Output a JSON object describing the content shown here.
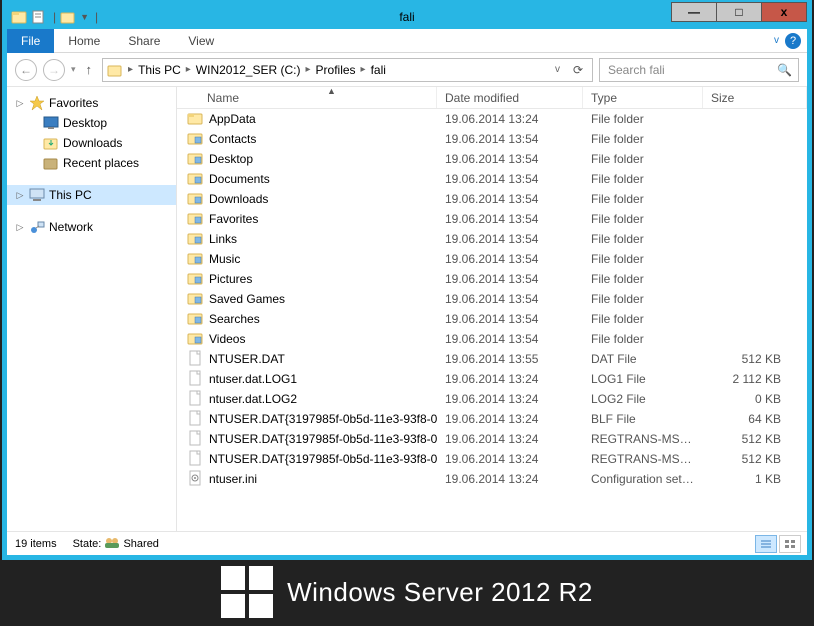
{
  "window": {
    "title": "fali"
  },
  "ribbon": {
    "file": "File",
    "tabs": [
      "Home",
      "Share",
      "View"
    ]
  },
  "breadcrumbs": [
    "This PC",
    "WIN2012_SER (C:)",
    "Profiles",
    "fali"
  ],
  "search": {
    "placeholder": "Search fali"
  },
  "navpane": {
    "favorites": {
      "label": "Favorites",
      "items": [
        "Desktop",
        "Downloads",
        "Recent places"
      ]
    },
    "thispc": {
      "label": "This PC"
    },
    "network": {
      "label": "Network"
    }
  },
  "columns": {
    "name": "Name",
    "date": "Date modified",
    "type": "Type",
    "size": "Size"
  },
  "rows": [
    {
      "icon": "folder",
      "name": "AppData",
      "date": "19.06.2014 13:24",
      "type": "File folder",
      "size": ""
    },
    {
      "icon": "special",
      "name": "Contacts",
      "date": "19.06.2014 13:54",
      "type": "File folder",
      "size": ""
    },
    {
      "icon": "special",
      "name": "Desktop",
      "date": "19.06.2014 13:54",
      "type": "File folder",
      "size": ""
    },
    {
      "icon": "special",
      "name": "Documents",
      "date": "19.06.2014 13:54",
      "type": "File folder",
      "size": ""
    },
    {
      "icon": "special",
      "name": "Downloads",
      "date": "19.06.2014 13:54",
      "type": "File folder",
      "size": ""
    },
    {
      "icon": "special",
      "name": "Favorites",
      "date": "19.06.2014 13:54",
      "type": "File folder",
      "size": ""
    },
    {
      "icon": "special",
      "name": "Links",
      "date": "19.06.2014 13:54",
      "type": "File folder",
      "size": ""
    },
    {
      "icon": "special",
      "name": "Music",
      "date": "19.06.2014 13:54",
      "type": "File folder",
      "size": ""
    },
    {
      "icon": "special",
      "name": "Pictures",
      "date": "19.06.2014 13:54",
      "type": "File folder",
      "size": ""
    },
    {
      "icon": "special",
      "name": "Saved Games",
      "date": "19.06.2014 13:54",
      "type": "File folder",
      "size": ""
    },
    {
      "icon": "special",
      "name": "Searches",
      "date": "19.06.2014 13:54",
      "type": "File folder",
      "size": ""
    },
    {
      "icon": "special",
      "name": "Videos",
      "date": "19.06.2014 13:54",
      "type": "File folder",
      "size": ""
    },
    {
      "icon": "file",
      "name": "NTUSER.DAT",
      "date": "19.06.2014 13:55",
      "type": "DAT File",
      "size": "512 KB"
    },
    {
      "icon": "file",
      "name": "ntuser.dat.LOG1",
      "date": "19.06.2014 13:24",
      "type": "LOG1 File",
      "size": "2 112 KB"
    },
    {
      "icon": "file",
      "name": "ntuser.dat.LOG2",
      "date": "19.06.2014 13:24",
      "type": "LOG2 File",
      "size": "0 KB"
    },
    {
      "icon": "file",
      "name": "NTUSER.DAT{3197985f-0b5d-11e3-93f8-0...",
      "date": "19.06.2014 13:24",
      "type": "BLF File",
      "size": "64 KB"
    },
    {
      "icon": "file",
      "name": "NTUSER.DAT{3197985f-0b5d-11e3-93f8-0...",
      "date": "19.06.2014 13:24",
      "type": "REGTRANS-MS File",
      "size": "512 KB"
    },
    {
      "icon": "file",
      "name": "NTUSER.DAT{3197985f-0b5d-11e3-93f8-0...",
      "date": "19.06.2014 13:24",
      "type": "REGTRANS-MS File",
      "size": "512 KB"
    },
    {
      "icon": "ini",
      "name": "ntuser.ini",
      "date": "19.06.2014 13:24",
      "type": "Configuration sett...",
      "size": "1 KB"
    }
  ],
  "status": {
    "count": "19 items",
    "state_label": "State:",
    "state_value": "Shared"
  },
  "branding": {
    "text": "Windows Server 2012",
    "suffix": "R2"
  }
}
